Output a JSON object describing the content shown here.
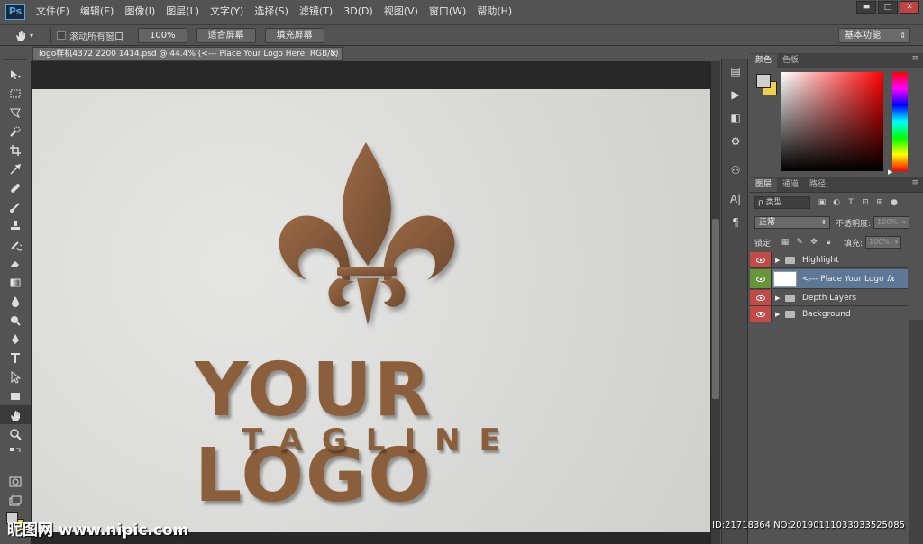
{
  "app": {
    "logo": "Ps"
  },
  "menu": [
    "文件(F)",
    "编辑(E)",
    "图像(I)",
    "图层(L)",
    "文字(Y)",
    "选择(S)",
    "滤镜(T)",
    "3D(D)",
    "视图(V)",
    "窗口(W)",
    "帮助(H)"
  ],
  "window": {
    "minimize": "▬",
    "restore": "□",
    "close": "✕"
  },
  "options": {
    "tool_icon": "hand-icon",
    "scroll_all_label": "滚动所有窗口",
    "btn_100": "100%",
    "btn_fit": "适合屏幕",
    "btn_fill": "填充屏幕",
    "workspace": "基本功能"
  },
  "document": {
    "tab_title": "logo样机4372 2200 1414.psd @ 44.4% (<--- Place Your Logo Here, RGB/8)",
    "close": "×",
    "logo_text": "YOUR LOGO",
    "tagline": "TAGLINE"
  },
  "colors": {
    "foreground": "#cfcfcf",
    "background": "#f2d04c",
    "canvas": "#dcdcda",
    "wood": "#8b5e3c"
  },
  "color_panel": {
    "tabs": [
      "颜色",
      "色板"
    ]
  },
  "layers_panel": {
    "tabs": [
      "图层",
      "通道",
      "路径"
    ],
    "kind_filter": "ρ 类型",
    "blend_mode": "正常",
    "opacity_label": "不透明度:",
    "opacity_value": "100%",
    "lock_label": "锁定:",
    "fill_label": "填充:",
    "fill_value": "100%",
    "layers": [
      {
        "name": "Highlight",
        "type": "group"
      },
      {
        "name": "<--- Place Your Logo ...",
        "type": "smart",
        "fx": "fx"
      },
      {
        "name": "Depth Layers",
        "type": "group"
      },
      {
        "name": "Background",
        "type": "group"
      }
    ]
  },
  "watermark": {
    "left": "昵图网 www.nipic.com",
    "right": "ID:21718364 NO:20190111033033525085"
  }
}
